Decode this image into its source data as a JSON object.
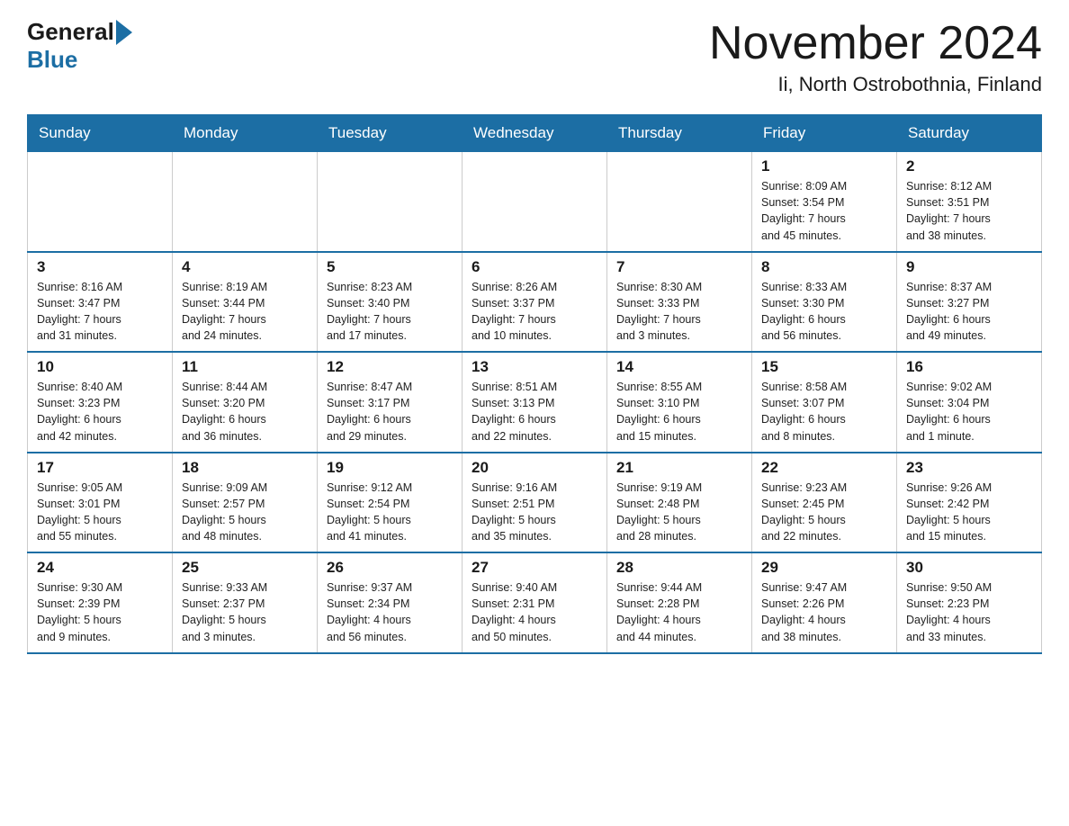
{
  "header": {
    "logo_general": "General",
    "logo_blue": "Blue",
    "title": "November 2024",
    "subtitle": "Ii, North Ostrobothnia, Finland"
  },
  "weekdays": [
    "Sunday",
    "Monday",
    "Tuesday",
    "Wednesday",
    "Thursday",
    "Friday",
    "Saturday"
  ],
  "weeks": [
    [
      {
        "day": "",
        "info": ""
      },
      {
        "day": "",
        "info": ""
      },
      {
        "day": "",
        "info": ""
      },
      {
        "day": "",
        "info": ""
      },
      {
        "day": "",
        "info": ""
      },
      {
        "day": "1",
        "info": "Sunrise: 8:09 AM\nSunset: 3:54 PM\nDaylight: 7 hours\nand 45 minutes."
      },
      {
        "day": "2",
        "info": "Sunrise: 8:12 AM\nSunset: 3:51 PM\nDaylight: 7 hours\nand 38 minutes."
      }
    ],
    [
      {
        "day": "3",
        "info": "Sunrise: 8:16 AM\nSunset: 3:47 PM\nDaylight: 7 hours\nand 31 minutes."
      },
      {
        "day": "4",
        "info": "Sunrise: 8:19 AM\nSunset: 3:44 PM\nDaylight: 7 hours\nand 24 minutes."
      },
      {
        "day": "5",
        "info": "Sunrise: 8:23 AM\nSunset: 3:40 PM\nDaylight: 7 hours\nand 17 minutes."
      },
      {
        "day": "6",
        "info": "Sunrise: 8:26 AM\nSunset: 3:37 PM\nDaylight: 7 hours\nand 10 minutes."
      },
      {
        "day": "7",
        "info": "Sunrise: 8:30 AM\nSunset: 3:33 PM\nDaylight: 7 hours\nand 3 minutes."
      },
      {
        "day": "8",
        "info": "Sunrise: 8:33 AM\nSunset: 3:30 PM\nDaylight: 6 hours\nand 56 minutes."
      },
      {
        "day": "9",
        "info": "Sunrise: 8:37 AM\nSunset: 3:27 PM\nDaylight: 6 hours\nand 49 minutes."
      }
    ],
    [
      {
        "day": "10",
        "info": "Sunrise: 8:40 AM\nSunset: 3:23 PM\nDaylight: 6 hours\nand 42 minutes."
      },
      {
        "day": "11",
        "info": "Sunrise: 8:44 AM\nSunset: 3:20 PM\nDaylight: 6 hours\nand 36 minutes."
      },
      {
        "day": "12",
        "info": "Sunrise: 8:47 AM\nSunset: 3:17 PM\nDaylight: 6 hours\nand 29 minutes."
      },
      {
        "day": "13",
        "info": "Sunrise: 8:51 AM\nSunset: 3:13 PM\nDaylight: 6 hours\nand 22 minutes."
      },
      {
        "day": "14",
        "info": "Sunrise: 8:55 AM\nSunset: 3:10 PM\nDaylight: 6 hours\nand 15 minutes."
      },
      {
        "day": "15",
        "info": "Sunrise: 8:58 AM\nSunset: 3:07 PM\nDaylight: 6 hours\nand 8 minutes."
      },
      {
        "day": "16",
        "info": "Sunrise: 9:02 AM\nSunset: 3:04 PM\nDaylight: 6 hours\nand 1 minute."
      }
    ],
    [
      {
        "day": "17",
        "info": "Sunrise: 9:05 AM\nSunset: 3:01 PM\nDaylight: 5 hours\nand 55 minutes."
      },
      {
        "day": "18",
        "info": "Sunrise: 9:09 AM\nSunset: 2:57 PM\nDaylight: 5 hours\nand 48 minutes."
      },
      {
        "day": "19",
        "info": "Sunrise: 9:12 AM\nSunset: 2:54 PM\nDaylight: 5 hours\nand 41 minutes."
      },
      {
        "day": "20",
        "info": "Sunrise: 9:16 AM\nSunset: 2:51 PM\nDaylight: 5 hours\nand 35 minutes."
      },
      {
        "day": "21",
        "info": "Sunrise: 9:19 AM\nSunset: 2:48 PM\nDaylight: 5 hours\nand 28 minutes."
      },
      {
        "day": "22",
        "info": "Sunrise: 9:23 AM\nSunset: 2:45 PM\nDaylight: 5 hours\nand 22 minutes."
      },
      {
        "day": "23",
        "info": "Sunrise: 9:26 AM\nSunset: 2:42 PM\nDaylight: 5 hours\nand 15 minutes."
      }
    ],
    [
      {
        "day": "24",
        "info": "Sunrise: 9:30 AM\nSunset: 2:39 PM\nDaylight: 5 hours\nand 9 minutes."
      },
      {
        "day": "25",
        "info": "Sunrise: 9:33 AM\nSunset: 2:37 PM\nDaylight: 5 hours\nand 3 minutes."
      },
      {
        "day": "26",
        "info": "Sunrise: 9:37 AM\nSunset: 2:34 PM\nDaylight: 4 hours\nand 56 minutes."
      },
      {
        "day": "27",
        "info": "Sunrise: 9:40 AM\nSunset: 2:31 PM\nDaylight: 4 hours\nand 50 minutes."
      },
      {
        "day": "28",
        "info": "Sunrise: 9:44 AM\nSunset: 2:28 PM\nDaylight: 4 hours\nand 44 minutes."
      },
      {
        "day": "29",
        "info": "Sunrise: 9:47 AM\nSunset: 2:26 PM\nDaylight: 4 hours\nand 38 minutes."
      },
      {
        "day": "30",
        "info": "Sunrise: 9:50 AM\nSunset: 2:23 PM\nDaylight: 4 hours\nand 33 minutes."
      }
    ]
  ]
}
